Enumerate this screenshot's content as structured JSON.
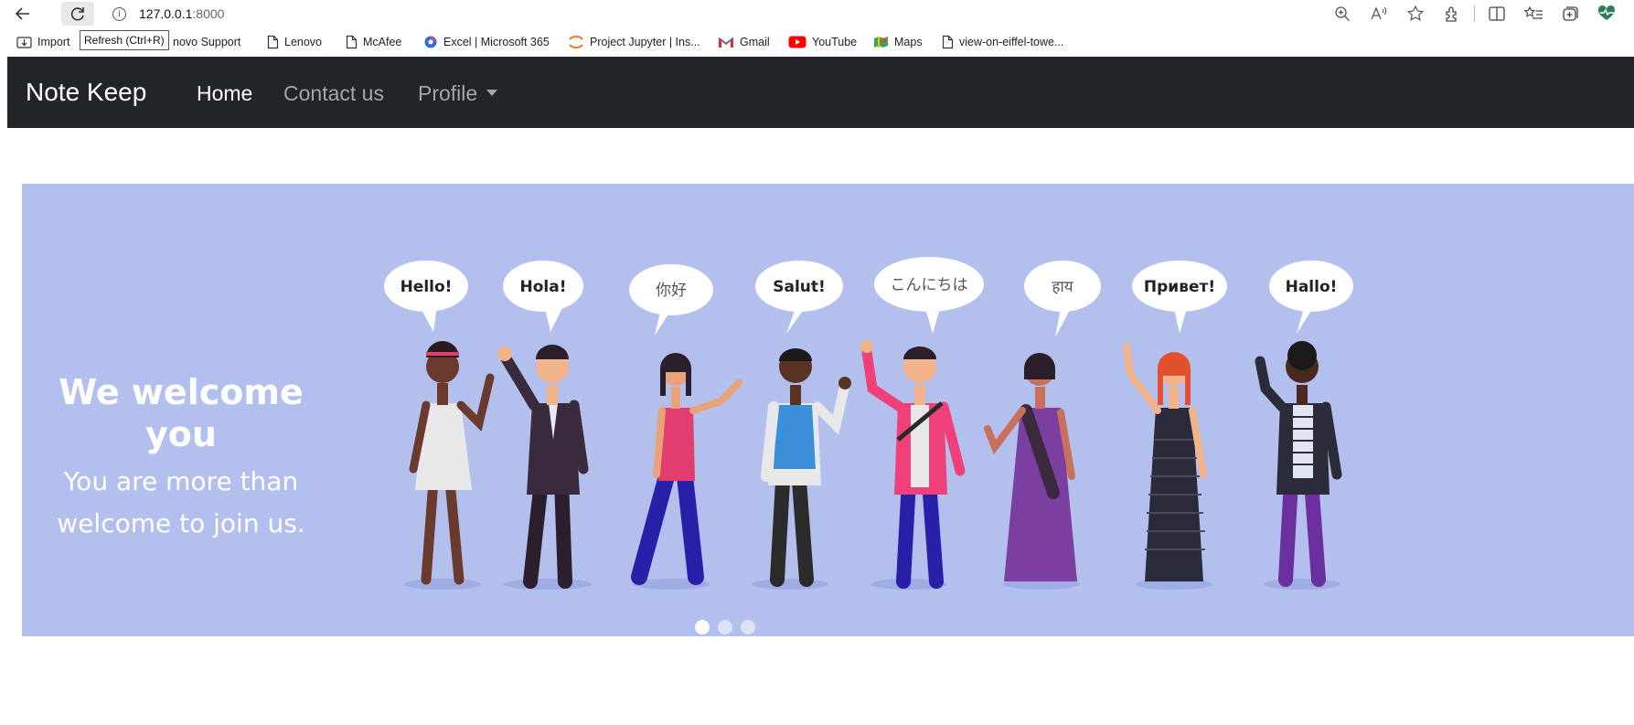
{
  "browser": {
    "url_host": "127.0.0.1",
    "url_port": ":8000",
    "refresh_tooltip": "Refresh (Ctrl+R)",
    "bookmarks": [
      {
        "label": "Import",
        "icon": "import-icon"
      },
      {
        "label": "Lenovo Support",
        "icon": "page-icon"
      },
      {
        "label": "Lenovo",
        "icon": "page-icon"
      },
      {
        "label": "McAfee",
        "icon": "page-icon"
      },
      {
        "label": "Excel | Microsoft 365",
        "icon": "office-icon"
      },
      {
        "label": "Project Jupyter | Ins...",
        "icon": "jupyter-icon"
      },
      {
        "label": "Gmail",
        "icon": "gmail-icon"
      },
      {
        "label": "YouTube",
        "icon": "youtube-icon"
      },
      {
        "label": "Maps",
        "icon": "maps-icon"
      },
      {
        "label": "view-on-eiffel-towe...",
        "icon": "page-icon"
      }
    ],
    "visible_partial_bookmark": "novo Support"
  },
  "navbar": {
    "brand": "Note Keep",
    "links": [
      {
        "label": "Home",
        "active": true
      },
      {
        "label": "Contact us",
        "active": false
      },
      {
        "label": "Profile",
        "active": false,
        "dropdown": true
      }
    ]
  },
  "carousel": {
    "heading": "We welcome you",
    "text": "You are more than welcome to join us.",
    "background": "#b3bfec",
    "indicators": [
      true,
      false,
      false
    ],
    "greetings": [
      "Hello!",
      "Hola!",
      "你好",
      "Salut!",
      "こんにちは",
      "हाय",
      "Привет!",
      "Hallo!"
    ]
  }
}
